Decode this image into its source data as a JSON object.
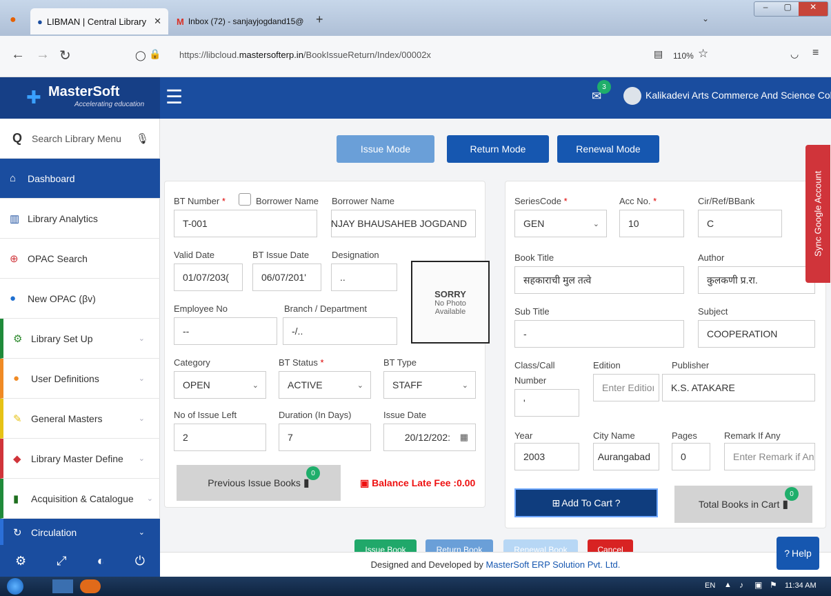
{
  "browser": {
    "tabs": [
      {
        "label": "LIBMAN | Central Library"
      },
      {
        "label": "Inbox (72) - sanjayjogdand15@"
      }
    ],
    "url_prefix": "https://libcloud.",
    "url_domain": "mastersofterp.in",
    "url_path": "/BookIssueReturn/Index/00002x",
    "zoom": "110%"
  },
  "app": {
    "brand": "MasterSoft",
    "tagline": "Accelerating education",
    "notification_count": "3",
    "college": "Kalikadevi Arts Commerce And Science College"
  },
  "sidebar": {
    "search_placeholder": "Search Library Menu",
    "items": [
      {
        "label": "Dashboard"
      },
      {
        "label": "Library Analytics"
      },
      {
        "label": "OPAC Search"
      },
      {
        "label": "New OPAC (βv)"
      },
      {
        "label": "Library Set Up"
      },
      {
        "label": "User Definitions"
      },
      {
        "label": "General Masters"
      },
      {
        "label": "Library Master Define"
      },
      {
        "label": "Acquisition & Catalogue"
      },
      {
        "label": "Circulation"
      }
    ]
  },
  "modes": {
    "issue": "Issue Mode",
    "return": "Return Mode",
    "renewal": "Renewal Mode"
  },
  "borrower": {
    "bt_number_label": "BT Number",
    "bt_number": "T-001",
    "borrower_name_check_label": "Borrower Name",
    "borrower_name_label": "Borrower Name",
    "borrower_name": "ANJAY BHAUSAHEB JOGDAND",
    "valid_date_label": "Valid Date",
    "valid_date": "01/07/203(",
    "bt_issue_date_label": "BT Issue Date",
    "bt_issue_date": "06/07/201'",
    "designation_label": "Designation",
    "designation": "..",
    "photo_sorry": "SORRY",
    "photo_line1": "No Photo",
    "photo_line2": "Available",
    "employee_no_label": "Employee No",
    "employee_no": "--",
    "branch_label": "Branch / Department",
    "branch": "-/..",
    "category_label": "Category",
    "category": "OPEN",
    "bt_status_label": "BT Status",
    "bt_status": "ACTIVE",
    "bt_type_label": "BT Type",
    "bt_type": "STAFF",
    "issue_left_label": "No of Issue Left",
    "issue_left": "2",
    "duration_label": "Duration (In Days)",
    "duration": "7",
    "issue_date_label": "Issue Date",
    "issue_date": "20/12/202:",
    "prev_issue_books": "Previous Issue Books",
    "prev_issue_count": "0",
    "balance_late_fee": "Balance Late Fee :0.00"
  },
  "book": {
    "series_code_label": "SeriesCode",
    "series_code": "GEN",
    "acc_no_label": "Acc No.",
    "acc_no": "10",
    "cir_label": "Cir/Ref/BBank",
    "cir": "C",
    "title_label": "Book Title",
    "title": "सहकाराची मुल तत्वे",
    "author_label": "Author",
    "author": "कुलकणी प्र.रा.",
    "subtitle_label": "Sub Title",
    "subtitle": "-",
    "subject_label": "Subject",
    "subject": "COOPERATION",
    "class_label_1": "Class/Call",
    "class_label_2": "Number",
    "class_value": "'",
    "edition_label": "Edition",
    "edition_placeholder": "Enter Editioı",
    "publisher_label": "Publisher",
    "publisher": "K.S. ATAKARE",
    "year_label": "Year",
    "year": "2003",
    "city_label": "City Name",
    "city": "Aurangabad",
    "pages_label": "Pages",
    "pages": "0",
    "remark_label": "Remark If Any",
    "remark_placeholder": "Enter Remark if An",
    "add_to_cart": "Add To Cart ?",
    "total_in_cart": "Total Books in Cart",
    "cart_count": "0"
  },
  "bottom_buttons": {
    "issue": "Issue Book",
    "return": "Return Book",
    "renewal": "Renewal Book",
    "cancel": "Cancel"
  },
  "footer": {
    "prefix": "Designed and Developed by ",
    "company": "MasterSoft ERP Solution Pvt. Ltd."
  },
  "help": "Help",
  "google_sync": "Sync Google Account",
  "taskbar": {
    "lang": "EN",
    "time": "11:34 AM"
  }
}
